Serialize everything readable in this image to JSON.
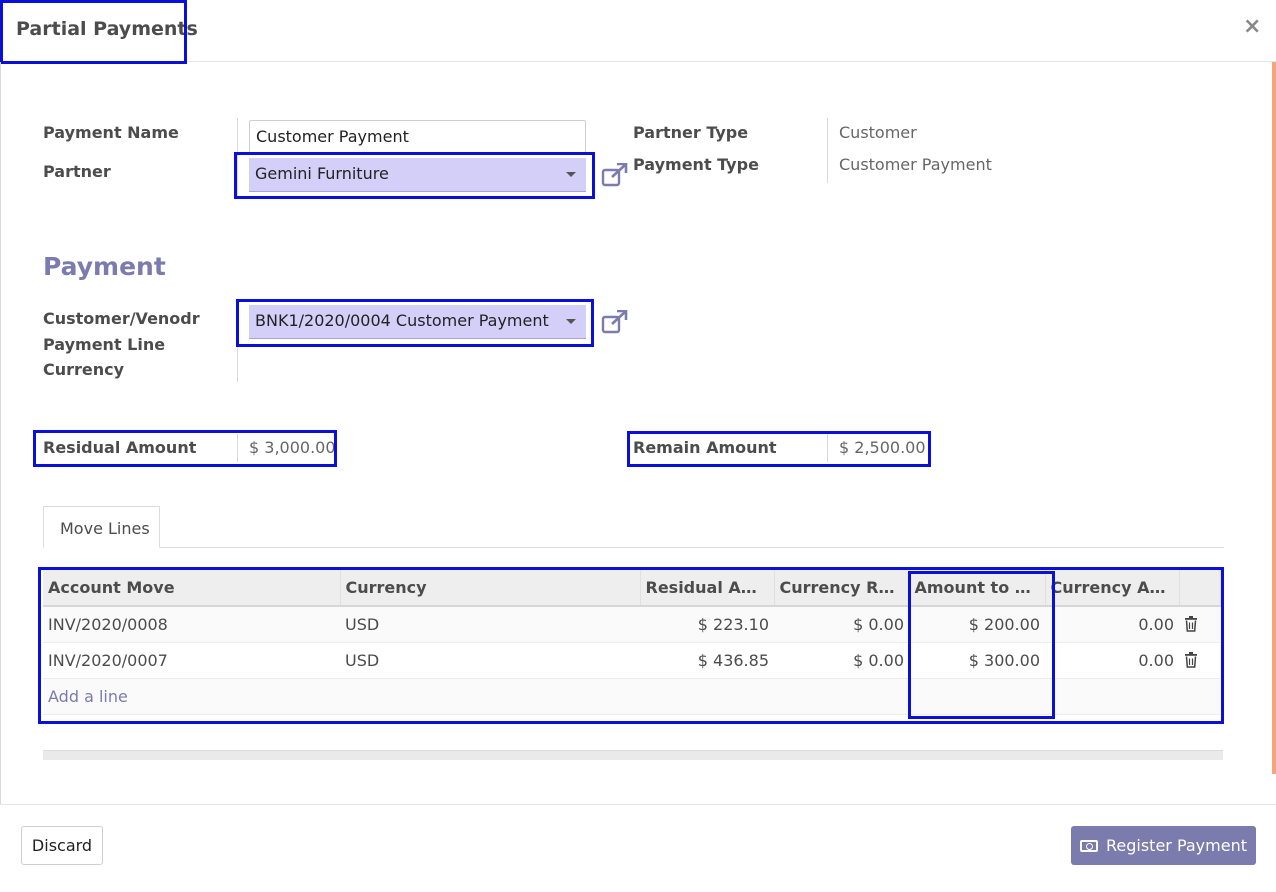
{
  "dialog": {
    "title": "Partial Payments",
    "close_glyph": "×"
  },
  "form": {
    "payment_name": {
      "label": "Payment Name",
      "value": "Customer Payment"
    },
    "partner": {
      "label": "Partner",
      "value": "Gemini Furniture"
    },
    "partner_type": {
      "label": "Partner Type",
      "value": "Customer"
    },
    "payment_type": {
      "label": "Payment Type",
      "value": "Customer Payment"
    }
  },
  "payment_section": {
    "title": "Payment",
    "line": {
      "label_1": "Customer/Venodr",
      "label_2": "Payment Line",
      "value": "BNK1/2020/0004 Customer Payment"
    },
    "currency_label": "Currency"
  },
  "amounts": {
    "residual": {
      "label": "Residual Amount",
      "value": "$ 3,000.00"
    },
    "remain": {
      "label": "Remain Amount",
      "value": "$ 2,500.00"
    }
  },
  "tabs": [
    {
      "label": "Move Lines"
    }
  ],
  "table": {
    "headers": [
      "Account Move",
      "Currency",
      "Residual Am…",
      "Currency Res…",
      "Amount to P…",
      "Currency Am…"
    ],
    "rows": [
      [
        "INV/2020/0008",
        "USD",
        "$ 223.10",
        "$ 0.00",
        "$ 200.00",
        "0.00"
      ],
      [
        "INV/2020/0007",
        "USD",
        "$ 436.85",
        "$ 0.00",
        "$ 300.00",
        "0.00"
      ]
    ],
    "add_line": "Add a line"
  },
  "footer": {
    "discard": "Discard",
    "register": "Register Payment"
  },
  "icons": {
    "external": "external-link-icon",
    "trash": "trash-icon",
    "cash": "money-icon",
    "caret": "caret-down-icon"
  },
  "colors": {
    "accent": "#7c7bad",
    "select_bg": "#d3cff9",
    "highlight": "#0a10d8"
  }
}
